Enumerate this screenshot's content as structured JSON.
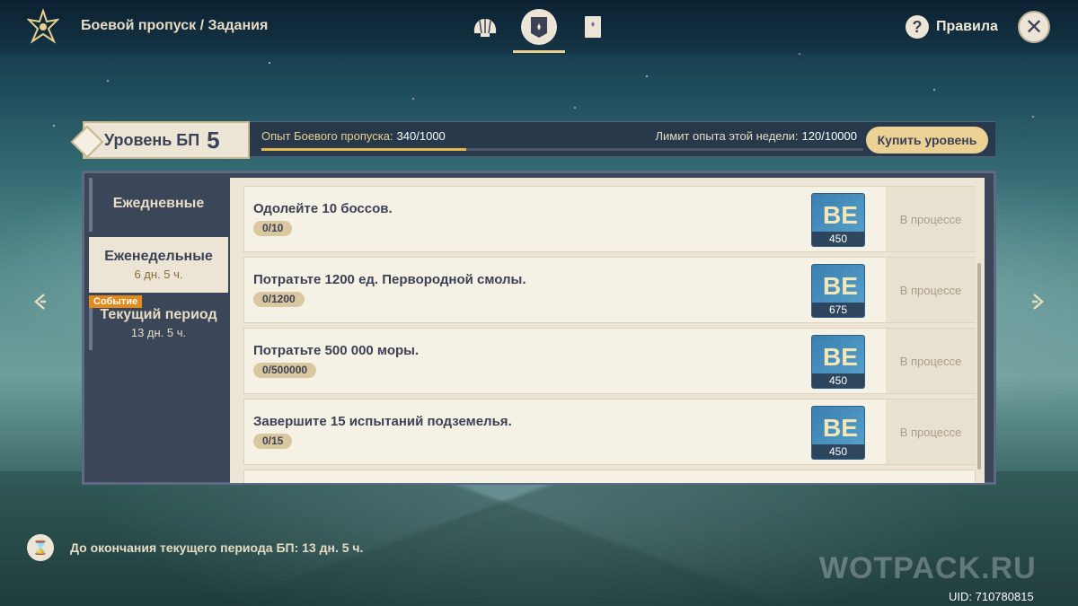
{
  "header": {
    "breadcrumb": "Боевой пропуск / Задания",
    "tabs": [
      {
        "icon": "shell-icon",
        "active": false
      },
      {
        "icon": "banner-icon",
        "active": true
      },
      {
        "icon": "card-icon",
        "active": false
      }
    ],
    "help_label": "Правила",
    "close_icon": "close-icon"
  },
  "level": {
    "label": "Уровень БП",
    "value": "5",
    "xp_label": "Опыт Боевого пропуска:",
    "xp_value": "340/1000",
    "xp_fraction": 0.34,
    "limit_label": "Лимит опыта этой недели:",
    "limit_value": "120/10000",
    "buy_label": "Купить уровень"
  },
  "sidebar": {
    "items": [
      {
        "label": "Ежедневные",
        "sub": ""
      },
      {
        "label": "Еженедельные",
        "sub": "6 дн. 5 ч."
      },
      {
        "label": "Текущий период",
        "sub": "13 дн. 5 ч.",
        "tag": "Событие"
      }
    ]
  },
  "tasks": [
    {
      "title": "Одолейте 10 боссов.",
      "progress": "0/10",
      "reward": "450",
      "status": "В процессе"
    },
    {
      "title": "Потратьте 1200 ед. Первородной смолы.",
      "progress": "0/1200",
      "reward": "675",
      "status": "В процессе"
    },
    {
      "title": "Потратьте 500 000 моры.",
      "progress": "0/500000",
      "reward": "450",
      "status": "В процессе"
    },
    {
      "title": "Завершите 15 испытаний подземелья.",
      "progress": "0/15",
      "reward": "450",
      "status": "В процессе"
    }
  ],
  "footer": {
    "period_label": "До окончания текущего периода БП:",
    "period_value": "13 дн. 5 ч.",
    "watermark": "WOTPACK.RU",
    "uid": "UID: 710780815"
  },
  "colors": {
    "accent_gold": "#e8cf8e",
    "panel_dark": "#3c4659",
    "card_bg": "#f6f1e5",
    "event_orange": "#e38a1c"
  }
}
